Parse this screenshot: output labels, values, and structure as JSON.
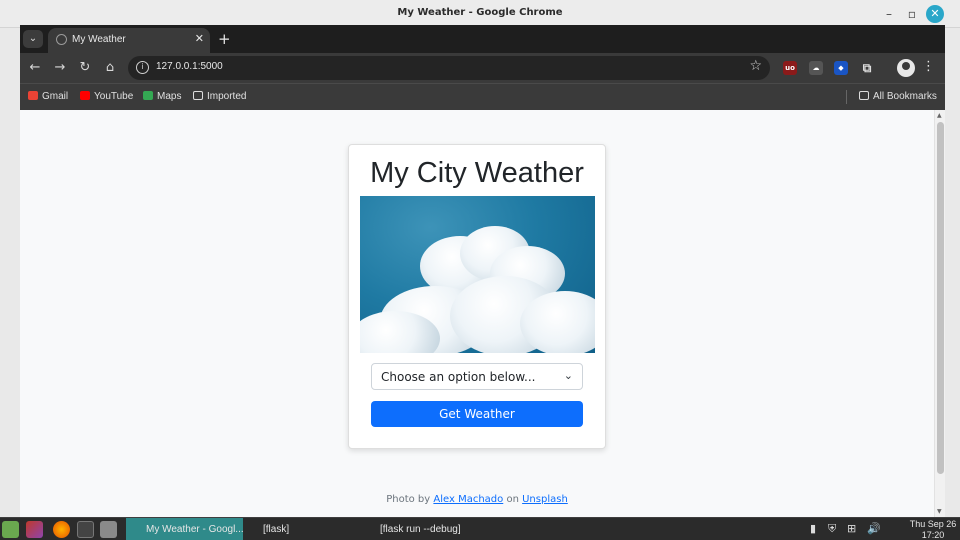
{
  "window": {
    "title": "My Weather - Google Chrome"
  },
  "browser": {
    "tab_title": "My Weather",
    "url": "127.0.0.1:5000",
    "bookmarks": [
      "Gmail",
      "YouTube",
      "Maps",
      "Imported"
    ],
    "all_bookmarks": "All Bookmarks"
  },
  "page": {
    "title": "My City Weather",
    "select_placeholder": "Choose an option below...",
    "button_label": "Get Weather",
    "credit": {
      "prefix": "Photo by",
      "author": "Alex Machado",
      "middle": "on",
      "source": "Unsplash"
    }
  },
  "taskbar": {
    "tasks": [
      "My Weather - Googl...",
      "[flask]",
      "[flask run --debug]"
    ],
    "clock_day": "Thu Sep 26",
    "clock_time": "17:20"
  },
  "colors": {
    "primary": "#0d6efd",
    "taskbar_active": "#2f8a8a"
  }
}
